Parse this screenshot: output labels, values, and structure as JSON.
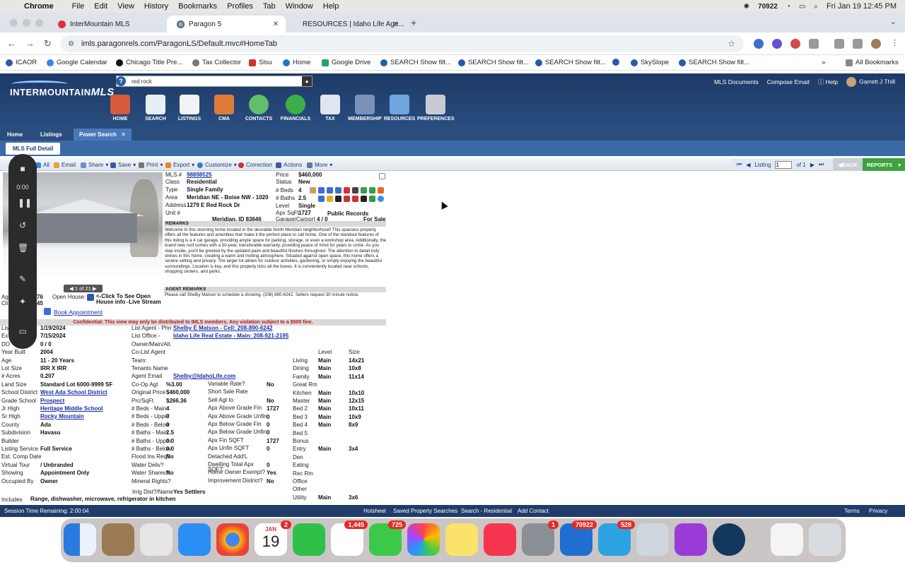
{
  "menubar": {
    "app": "Chrome",
    "items": [
      "File",
      "Edit",
      "View",
      "History",
      "Bookmarks",
      "Profiles",
      "Tab",
      "Window",
      "Help"
    ],
    "status": {
      "count": "70922",
      "datetime": "Fri Jan 19  12:45 PM"
    }
  },
  "tabs": [
    {
      "title": "InterMountain MLS",
      "active": false
    },
    {
      "title": "Paragon 5",
      "active": true
    },
    {
      "title": "RESOURCES | Idaho Life Age...",
      "active": false
    }
  ],
  "url": "imls.paragonrels.com/ParagonLS/Default.mvc#HomeTab",
  "bookmarks": [
    "ICAOR",
    "Google Calendar",
    "Chicago Title Pre...",
    "Tax Collector",
    "Slsu",
    "Home",
    "Google Drive",
    "SEARCH Show filt...",
    "SEARCH Show filt...",
    "SEARCH Show filt...",
    "SkySlope",
    "SEARCH Show filt..."
  ],
  "all_bookmarks": "All Bookmarks",
  "mls": {
    "logo_top": "INTERMOUNTAIN",
    "logo_bottom": "MLS",
    "search_value": "red rock",
    "toplinks": {
      "docs": "MLS Documents",
      "compose": "Compose Email",
      "help": "Help",
      "user": "Garrett J Thill"
    },
    "nav": [
      "HOME",
      "SEARCH",
      "LISTINGS",
      "CMA",
      "CONTACTS",
      "FINANCIALS",
      "TAX",
      "MEMBERSHIP",
      "RESOURCES",
      "PREFERENCES"
    ],
    "tabs": [
      "Home",
      "Listings",
      "Power Search"
    ],
    "full_detail": "MLS Full Detail"
  },
  "actions": [
    "All",
    "Email",
    "Share",
    "Save",
    "Print",
    "Export",
    "Customize",
    "Correction",
    "Actions",
    "More"
  ],
  "pager": {
    "label": "Listing",
    "value": "1",
    "of": "of 1"
  },
  "back": "BACK",
  "reports": "REPORTS",
  "recorder": {
    "time": "0:00"
  },
  "photo_count": "1 of 21",
  "listing": {
    "mls_label": "MLS #",
    "mls": "98898525",
    "class_label": "Class",
    "class": "Residential",
    "type_label": "Type",
    "type": "Single Family",
    "area_label": "Area",
    "area": "Meridian NE - Boise NW - 1020",
    "address_label": "Address",
    "address": "1279 E Red Rock Dr",
    "unit_label": "Unit #",
    "city": "Meridian, ID  83646",
    "price_label": "Price",
    "price": "$460,000",
    "status_label": "Status",
    "status": "New",
    "beds_label": "# Beds",
    "beds": "4",
    "baths_label": "# Baths",
    "baths": "2.5",
    "level_label": "Level",
    "level": "Single",
    "sqft_label": "Apx SqFt",
    "sqft": "1727",
    "sqft_src": "Public Records",
    "garage_label": "Garage/Carport",
    "garage": "4   /  0",
    "forsale": "For Sale"
  },
  "remarks_head": "REMARKS",
  "remarks": "Welcome to this stunning home located in the desirable North Meridian neighborhood! This spacious property offers all the features and amenities that make it the perfect place to call home. One of the standout features of this listing is a 4 car garage, providing ample space for parking, storage, or even a workshop area. Additionally, the brand new roof comes with a 50-year, transferable warranty, providing peace of mind for years to come. As you step inside, you'll be greeted by the updated paint and beautiful finishes throughout. The attention to detail truly shines in this home, creating a warm and inviting atmosphere. Situated against open space, this home offers a serene setting and privacy. The larger lot allows for outdoor activities, gardening, or simply enjoying the beautiful surroundings. Location is key, and this property ticks all the boxes. It is conveniently located near schools, shopping centers, and parks.",
  "agent_remarks_head": "AGENT REMARKS",
  "agent_remarks": "Please call Shelby Matson to schedule a showing. (208) 890-6242. Sellers request 30 minute notice.",
  "open_house": {
    "label": "Open House:",
    "text1": "<-Click To See Open",
    "text2": "House info -Live Stream",
    "book": "Book Appointment",
    "left1": "Ag",
    "left1v": "76",
    "left2": "Cli",
    "left2v": "45"
  },
  "confidential": "Confidential: This view may only be distributed to IMLS members. Any violation subject to a $500 fine.",
  "col1": [
    {
      "l": "Lis",
      "v": "1/19/2024"
    },
    {
      "l": "Ex",
      "v": "7/15/2024"
    },
    {
      "l": "DO",
      "v": "0      /   0"
    },
    {
      "l": "Year Built",
      "v": "2004"
    },
    {
      "l": "Age",
      "v": "11 - 20 Years"
    },
    {
      "l": "Lot Size",
      "v": "IRR          X IRR"
    },
    {
      "l": "# Acres",
      "v": "0.207"
    },
    {
      "l": "Land Size",
      "v": "Standard Lot 6000-9999 SF"
    },
    {
      "l": "School District",
      "v": "West Ada School District",
      "link": true
    },
    {
      "l": "Grade School",
      "v": "Prospect",
      "link": true
    },
    {
      "l": "Jr High",
      "v": "Heritage Middle School",
      "link": true
    },
    {
      "l": "Sr High",
      "v": "Rocky Mountain",
      "link": true
    },
    {
      "l": "County",
      "v": "Ada"
    },
    {
      "l": "Subdivision",
      "v": "Havasu"
    },
    {
      "l": "Builder",
      "v": ""
    },
    {
      "l": "Listing Service",
      "v": "Full Service"
    },
    {
      "l": "Est. Comp Date",
      "v": ""
    },
    {
      "l": "Virtual Tour",
      "v": "/  Unbranded"
    },
    {
      "l": "Showing",
      "v": "Appointment Only"
    },
    {
      "l": "Occupied By",
      "v": "Owner"
    }
  ],
  "includes": {
    "l": "Includes",
    "v": "Range, dishwasher, microwave, refrigerator in kitchen"
  },
  "col2": [
    {
      "l": "List Agent - Phn",
      "v": "Shelby E Matson - Cell: 208-890-6242",
      "link": true
    },
    {
      "l": "List Office -",
      "v": "Idaho Life Real Estate - Main: 208-921-2195",
      "link": true
    },
    {
      "l": "Owner/Main/Alt.",
      "v": ""
    },
    {
      "l": "Co-List Agent",
      "v": ""
    },
    {
      "l": "Team:",
      "v": ""
    },
    {
      "l": "Tenants Name",
      "v": ""
    },
    {
      "l": "Agent Email",
      "v": "Shelby@IdahoLife.com",
      "link": true
    },
    {
      "l": "Co-Op Agt",
      "v": "%3.00"
    },
    {
      "l": "Original Price",
      "v": "$460,000"
    },
    {
      "l": "Prc/SqFt",
      "v": "$266.36"
    },
    {
      "l": "# Beds - Main",
      "v": "4"
    },
    {
      "l": "# Beds - Upper",
      "v": "0"
    },
    {
      "l": "# Beds - Below",
      "v": "0"
    },
    {
      "l": "# Baths - Main",
      "v": "2.5"
    },
    {
      "l": "# Baths - Upper",
      "v": "0.0"
    },
    {
      "l": "# Baths - Below",
      "v": "0.0"
    },
    {
      "l": "Flood Ins Req?",
      "v": "No"
    },
    {
      "l": "Water Deliv?",
      "v": ""
    },
    {
      "l": "Water Shares?",
      "v": "No"
    },
    {
      "l": "Mineral Rights?",
      "v": ""
    }
  ],
  "irrig": {
    "l": "Irrig Dist?/Name",
    "v": "Yes     Settlers"
  },
  "col3": [
    {
      "l": "Variable Rate?",
      "v": "No"
    },
    {
      "l": "Short Sale Rate",
      "v": ""
    },
    {
      "l": "Sell Agt to",
      "v": "No"
    },
    {
      "l": "Apx Above Grade Fin",
      "v": "1727"
    },
    {
      "l": "Apx Above Grade Unfin",
      "v": "0"
    },
    {
      "l": "Apx Below Grade Fin",
      "v": "0"
    },
    {
      "l": "Apx Below Grade Unfin",
      "v": "0"
    },
    {
      "l": "Apx Fin SQFT",
      "v": "1727"
    },
    {
      "l": "Apx Unfin SQFT",
      "v": "0"
    },
    {
      "l": "Detached Add'L",
      "v": ""
    },
    {
      "l": "Dwelling Total Apx SQFT:",
      "v": "0"
    },
    {
      "l": "Home Owner Exempt?",
      "v": "Yes"
    },
    {
      "l": "Improvement District?",
      "v": "No"
    }
  ],
  "rooms_head": {
    "level": "Level",
    "size": "Size"
  },
  "rooms": [
    {
      "n": "Living",
      "lv": "Main",
      "s": "14x21"
    },
    {
      "n": "Dining",
      "lv": "Main",
      "s": "10x8"
    },
    {
      "n": "Family",
      "lv": "Main",
      "s": "11x14"
    },
    {
      "n": "Great Rm",
      "lv": "",
      "s": ""
    },
    {
      "n": "Kitchen",
      "lv": "Main",
      "s": "10x10"
    },
    {
      "n": "Master",
      "lv": "Main",
      "s": "12x15"
    },
    {
      "n": "Bed 2",
      "lv": "Main",
      "s": "10x11"
    },
    {
      "n": "Bed 3",
      "lv": "Main",
      "s": "10x9"
    },
    {
      "n": "Bed 4",
      "lv": "Main",
      "s": "8x9"
    },
    {
      "n": "Bed 5",
      "lv": "",
      "s": ""
    },
    {
      "n": "Bonus",
      "lv": "",
      "s": ""
    },
    {
      "n": "Entry",
      "lv": "Main",
      "s": "3x4"
    },
    {
      "n": "Den",
      "lv": "",
      "s": ""
    },
    {
      "n": "Eating",
      "lv": "",
      "s": ""
    },
    {
      "n": "Rec Rm",
      "lv": "",
      "s": ""
    },
    {
      "n": "Office",
      "lv": "",
      "s": ""
    },
    {
      "n": "Other",
      "lv": "",
      "s": ""
    },
    {
      "n": "Utility",
      "lv": "Main",
      "s": "3x6"
    }
  ],
  "statusbar": {
    "session": "Session Time Remaining: 2:00:04",
    "hotsheet": "Hotsheet",
    "saved": "Saved Property Searches",
    "search": "Search - Residential",
    "contact": "Add Contact",
    "terms": "Terms",
    "privacy": "Privacy"
  },
  "dock": {
    "cal_month": "JAN",
    "cal_day": "19",
    "badges": {
      "calendar": "2",
      "reminders": "1,445",
      "messages": "725",
      "settings": "1",
      "outlook": "70922",
      "telegram": "528"
    }
  }
}
